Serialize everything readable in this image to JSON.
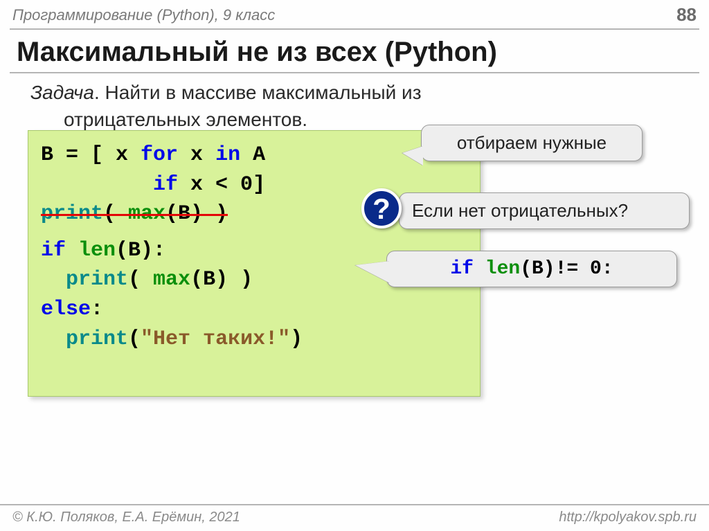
{
  "header": {
    "course": "Программирование (Python), 9 класс",
    "page": "88"
  },
  "title": "Максимальный не из всех (Python)",
  "task": {
    "label": "Задача",
    "line1": ". Найти в массиве максимальный из",
    "line2": "отрицательных элементов."
  },
  "code": {
    "l1a": "B = [ x ",
    "l1_for": "for",
    "l1b": " x ",
    "l1_in": "in",
    "l1c": " A",
    "l2_indent": "         ",
    "l2_if": "if",
    "l2b": " x < 0]",
    "l3_print": "print",
    "l3_open": "( ",
    "l3_max": "max",
    "l3_close": "(B) )",
    "l4_if": "if",
    "l4b": " ",
    "l4_len": "len",
    "l4c": "(B):",
    "l5_indent": "  ",
    "l5_print": "print",
    "l5_open": "( ",
    "l5_max": "max",
    "l5_close": "(B) )",
    "l6_else": "else",
    "l6b": ":",
    "l7_indent": "  ",
    "l7_print": "print",
    "l7_open": "(",
    "l7_str": "\"Нет таких!\"",
    "l7_close": ")"
  },
  "callouts": {
    "c1": "отбираем нужные",
    "c2": "Если нет отрицательных?",
    "c3_if": "if",
    "c3_b": " ",
    "c3_len": "len",
    "c3_c": "(B)!= 0:"
  },
  "qmark": "?",
  "footer": {
    "left": "© К.Ю. Поляков, Е.А. Ерёмин, 2021",
    "right": "http://kpolyakov.spb.ru"
  }
}
